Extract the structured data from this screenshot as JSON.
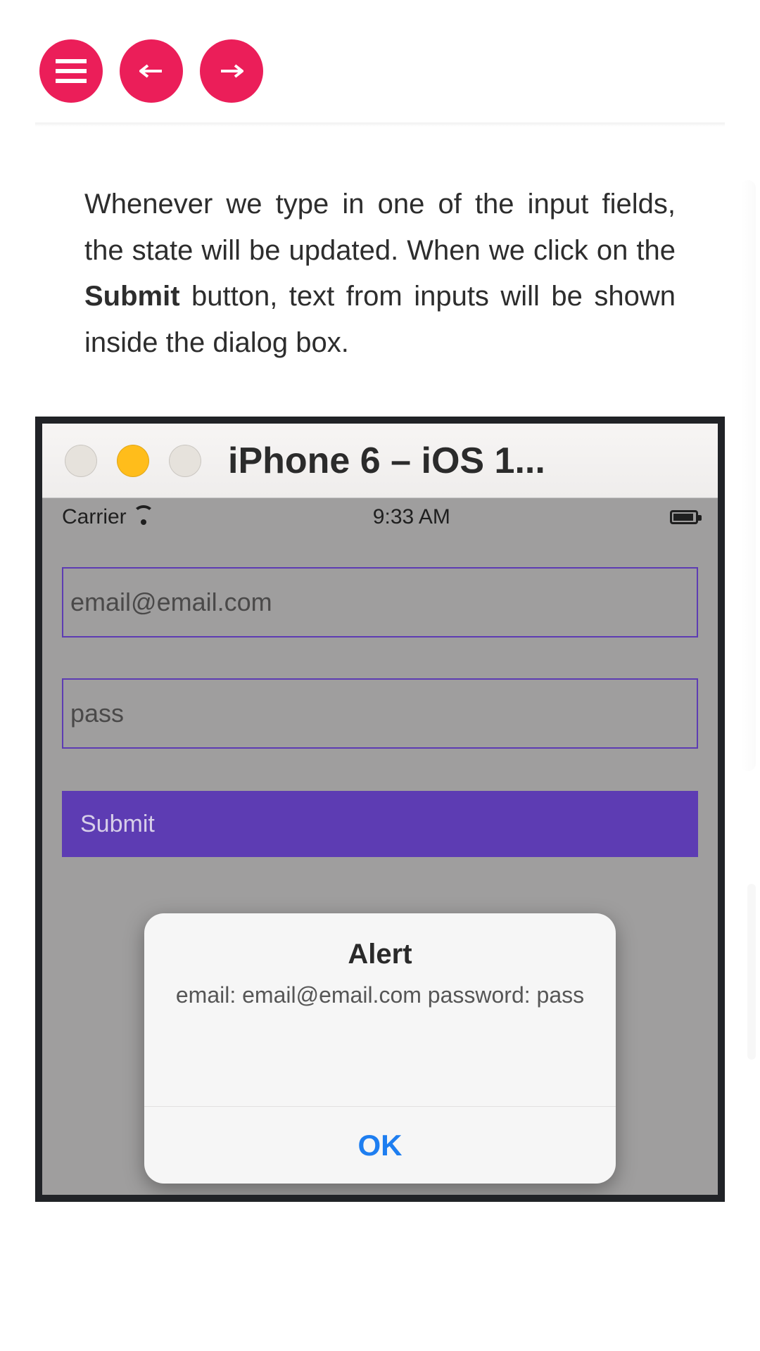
{
  "nav": {
    "menu_icon": "menu-icon",
    "prev_icon": "arrow-left-icon",
    "next_icon": "arrow-right-icon"
  },
  "paragraph": {
    "pre": "Whenever we type in one of the input fields, the state will be updated. When we click on the ",
    "bold": "Submit",
    "post": " button, text from inputs will be shown inside the dialog box."
  },
  "simulator": {
    "title": "iPhone 6 – iOS 1...",
    "status": {
      "carrier": "Carrier",
      "time": "9:33 AM"
    },
    "fields": {
      "email_value": "email@email.com",
      "password_value": "pass"
    },
    "submit_label": "Submit",
    "alert": {
      "title": "Alert",
      "message": "email: email@email.com password: pass",
      "ok_label": "OK"
    }
  },
  "colors": {
    "accent_red": "#eb1e59",
    "field_border": "#5d3cb3",
    "submit_bg": "#5d3cb3",
    "ok_text": "#1e7ef0",
    "titlebar_dot_yellow": "#ffbd1b"
  }
}
